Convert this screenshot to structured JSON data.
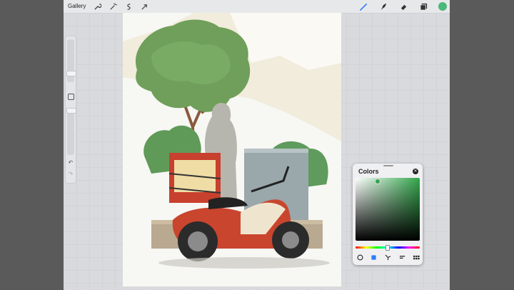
{
  "topbar": {
    "gallery_label": "Gallery",
    "left_tools": [
      "wrench-icon",
      "magic-wand-icon",
      "selection-icon",
      "transform-arrow-icon"
    ],
    "right_tools": [
      "brush-icon",
      "smudge-icon",
      "eraser-icon",
      "layers-icon"
    ],
    "current_color": "#4cb87a"
  },
  "colors_panel": {
    "title": "Colors",
    "selected_color": "#32a64b",
    "modes": [
      "disc-mode-icon",
      "classic-mode-icon",
      "harmony-mode-icon",
      "value-mode-icon",
      "palettes-mode-icon"
    ]
  },
  "colors": {
    "accent": "#2f7cf6"
  }
}
